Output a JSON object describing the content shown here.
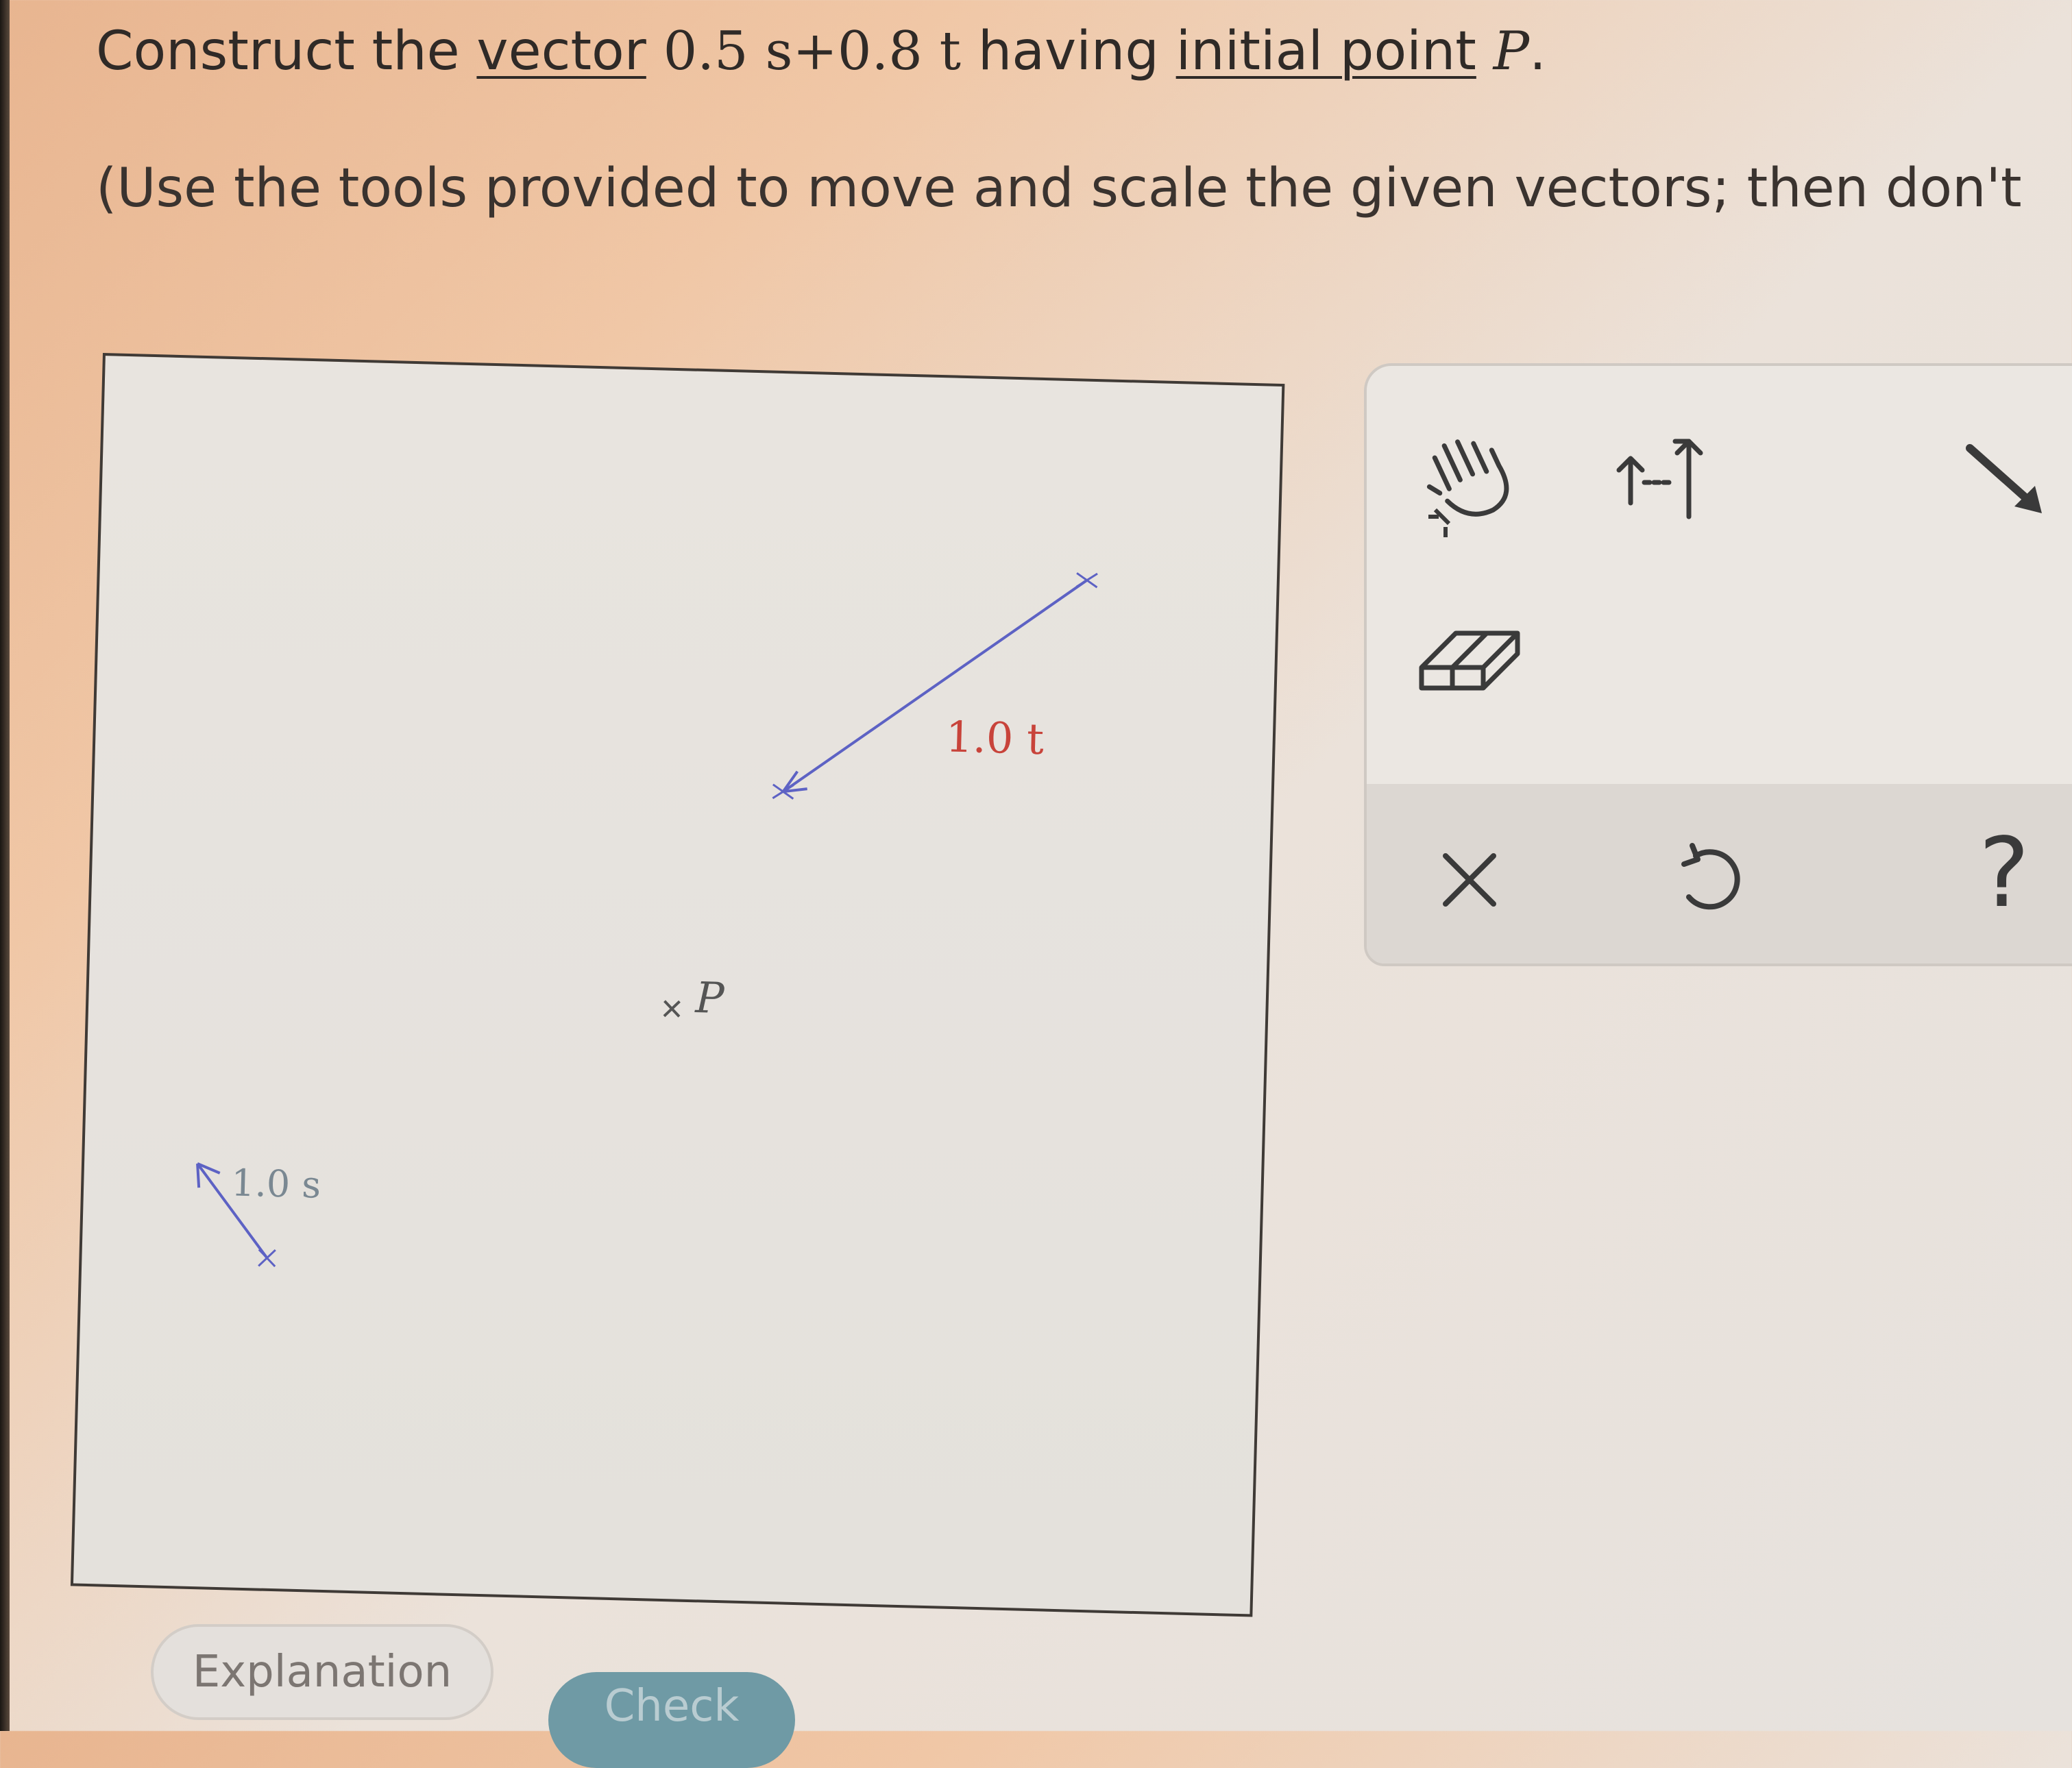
{
  "question": {
    "part1": "Construct the ",
    "link1": "vector",
    "math": " 0.5 s+0.8 t ",
    "part2": "having ",
    "link2": "initial point",
    "point": " P",
    "end": "."
  },
  "instruction": "(Use the tools provided to move and scale the given vectors; then don't",
  "canvas": {
    "vector_t_label": "1.0 t",
    "vector_s_label": "1.0 s",
    "point_label": "P",
    "colors": {
      "vector": "#5d62c4",
      "label_t": "#c8433a",
      "label_s": "#7a8892",
      "point": "#555555"
    }
  },
  "toolbar": {
    "tools": [
      "move-hand-icon",
      "scale-vector-icon",
      "draw-vector-icon",
      "eraser-icon",
      "clear-x-icon",
      "undo-icon",
      "help-icon"
    ],
    "help_label": "?"
  },
  "buttons": {
    "explanation": "Explanation",
    "check": "Check"
  }
}
